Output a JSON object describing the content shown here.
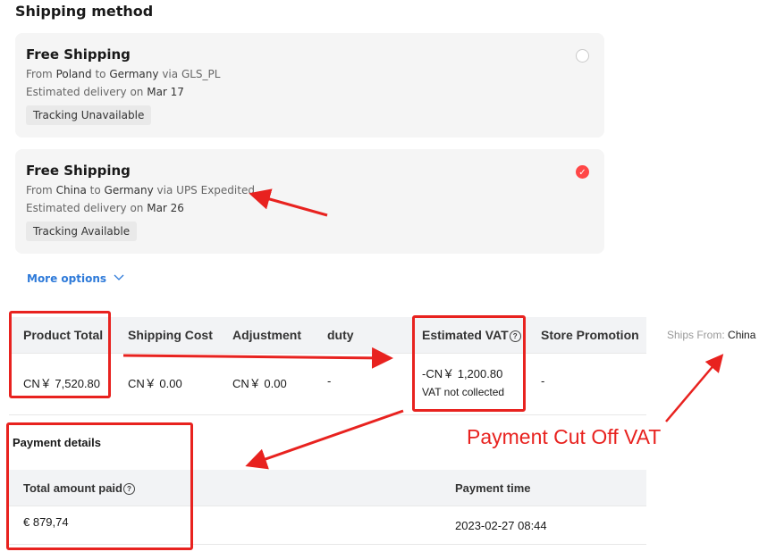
{
  "shipping": {
    "title": "Shipping method",
    "options": [
      {
        "title": "Free Shipping",
        "from_word": "From",
        "from": "Poland",
        "to_word": "to",
        "to": "Germany",
        "via_word": "via",
        "carrier": "GLS_PL",
        "eta_prefix": "Estimated delivery on",
        "eta": "Mar 17",
        "tag": "Tracking Unavailable",
        "selected": false
      },
      {
        "title": "Free Shipping",
        "from_word": "From",
        "from": "China",
        "to_word": "to",
        "to": "Germany",
        "via_word": "via",
        "carrier": "UPS Expedited",
        "eta_prefix": "Estimated delivery on",
        "eta": "Mar 26",
        "tag": "Tracking Available",
        "selected": true
      }
    ],
    "more_options": "More options"
  },
  "summary": {
    "headers": {
      "product_total": "Product Total",
      "shipping_cost": "Shipping Cost",
      "adjustment": "Adjustment",
      "duty": "duty",
      "estimated_vat": "Estimated VAT",
      "store_promotion": "Store Promotion"
    },
    "values": {
      "product_total": "CN￥ 7,520.80",
      "shipping_cost": "CN￥ 0.00",
      "adjustment": "CN￥ 0.00",
      "duty": "-",
      "estimated_vat": "-CN￥ 1,200.80",
      "vat_note": "VAT not collected",
      "store_promotion": "-"
    },
    "ships_from_label": "Ships From:",
    "ships_from": "China"
  },
  "payment": {
    "title": "Payment details",
    "headers": {
      "total_amount_paid": "Total amount paid",
      "payment_time": "Payment time"
    },
    "values": {
      "total_amount_paid": "€ 879,74",
      "payment_time": "2023-02-27 08:44"
    }
  },
  "annotation": {
    "label": "Payment Cut Off VAT",
    "color": "#e8221f"
  },
  "colors": {
    "accent": "#ff4747",
    "link": "#2e7ad9"
  },
  "icons": {
    "help": "question-circle-icon",
    "check": "check-icon",
    "chevron": "chevron-down-icon"
  }
}
